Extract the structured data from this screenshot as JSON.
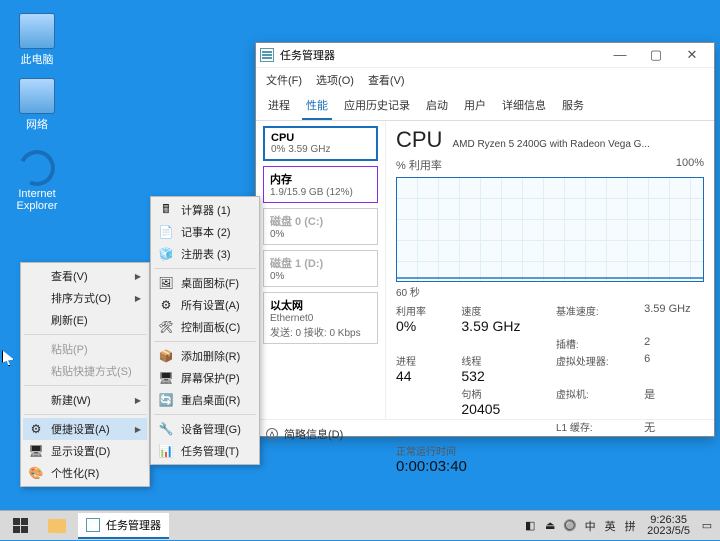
{
  "desktop": {
    "icons": [
      {
        "label": "此电脑"
      },
      {
        "label": "网络"
      },
      {
        "label": "Internet\nExplorer"
      }
    ]
  },
  "task_manager": {
    "title": "任务管理器",
    "menus": [
      "文件(F)",
      "选项(O)",
      "查看(V)"
    ],
    "tabs": [
      "进程",
      "性能",
      "应用历史记录",
      "启动",
      "用户",
      "详细信息",
      "服务"
    ],
    "side_cards": [
      {
        "name": "CPU",
        "sub": "0% 3.59 GHz",
        "kind": "cpu"
      },
      {
        "name": "内存",
        "sub": "1.9/15.9 GB (12%)",
        "kind": "mem"
      },
      {
        "name": "磁盘 0 (C:)",
        "sub": "0%",
        "kind": "dim"
      },
      {
        "name": "磁盘 1 (D:)",
        "sub": "0%",
        "kind": "dim"
      },
      {
        "name": "以太网",
        "sub": "Ethernet0\n发送: 0 接收: 0 Kbps",
        "kind": "eth"
      }
    ],
    "cpu_panel": {
      "header": "CPU",
      "model": "AMD Ryzen 5 2400G with Radeon Vega G...",
      "util_label": "% 利用率",
      "util_max": "100%",
      "xaxis": "60 秒",
      "stats": {
        "util_k": "利用率",
        "util_v": "0%",
        "speed_k": "速度",
        "speed_v": "3.59 GHz",
        "base_k": "基准速度:",
        "base_v": "3.59 GHz",
        "sockets_k": "插槽:",
        "sockets_v": "2",
        "proc_k": "进程",
        "proc_v": "44",
        "thr_k": "线程",
        "thr_v": "532",
        "hnd_k": "句柄",
        "hnd_v": "20405",
        "virt_k": "虚拟处理器:",
        "virt_v": "6",
        "vm_k": "虚拟机:",
        "vm_v": "是",
        "l1_k": "L1 缓存:",
        "l1_v": "无"
      },
      "uptime_label": "正常运行时间",
      "uptime": "0:00:03:40"
    },
    "footer": "简略信息(D)"
  },
  "ctx_main": {
    "items": [
      {
        "label": "查看(V)",
        "sub": true
      },
      {
        "label": "排序方式(O)",
        "sub": true
      },
      {
        "label": "刷新(E)"
      },
      {
        "sep": true
      },
      {
        "label": "粘贴(P)",
        "dim": true
      },
      {
        "label": "粘贴快捷方式(S)",
        "dim": true
      },
      {
        "sep": true
      },
      {
        "label": "新建(W)",
        "sub": true
      },
      {
        "sep": true
      },
      {
        "label": "便捷设置(A)",
        "sub": true,
        "on": true,
        "ic": "⚙"
      },
      {
        "label": "显示设置(D)",
        "ic": "🖥"
      },
      {
        "label": "个性化(R)",
        "ic": "🎨"
      }
    ]
  },
  "ctx_sub": {
    "items": [
      {
        "label": "计算器",
        "short": "(1)",
        "ic": "🖩"
      },
      {
        "label": "记事本",
        "short": "(2)",
        "ic": "📄"
      },
      {
        "label": "注册表",
        "short": "(3)",
        "ic": "🧊"
      },
      {
        "sep": true
      },
      {
        "label": "桌面图标(F)",
        "ic": "🖼"
      },
      {
        "label": "所有设置(A)",
        "ic": "⚙"
      },
      {
        "label": "控制面板(C)",
        "ic": "🛠"
      },
      {
        "sep": true
      },
      {
        "label": "添加删除(R)",
        "ic": "📦"
      },
      {
        "label": "屏幕保护(P)",
        "ic": "🖥"
      },
      {
        "label": "重启桌面(R)",
        "ic": "🔄"
      },
      {
        "sep": true
      },
      {
        "label": "设备管理(G)",
        "ic": "🔧"
      },
      {
        "label": "任务管理(T)",
        "ic": "📊"
      }
    ]
  },
  "taskbar": {
    "app": "任务管理器",
    "tray": [
      "◧",
      "⏏",
      "🔘",
      "中",
      "英",
      "拼"
    ],
    "time": "9:26:35",
    "date": "2023/5/5"
  },
  "chart_data": {
    "type": "line",
    "title": "% 利用率",
    "xlabel": "60 秒",
    "ylabel": "% 利用率",
    "ylim": [
      0,
      100
    ],
    "x": [
      60,
      55,
      50,
      45,
      40,
      35,
      30,
      25,
      20,
      15,
      10,
      5,
      0
    ],
    "values": [
      0,
      0,
      0,
      0,
      0,
      0,
      0,
      0,
      0,
      0,
      0,
      0,
      0
    ]
  }
}
